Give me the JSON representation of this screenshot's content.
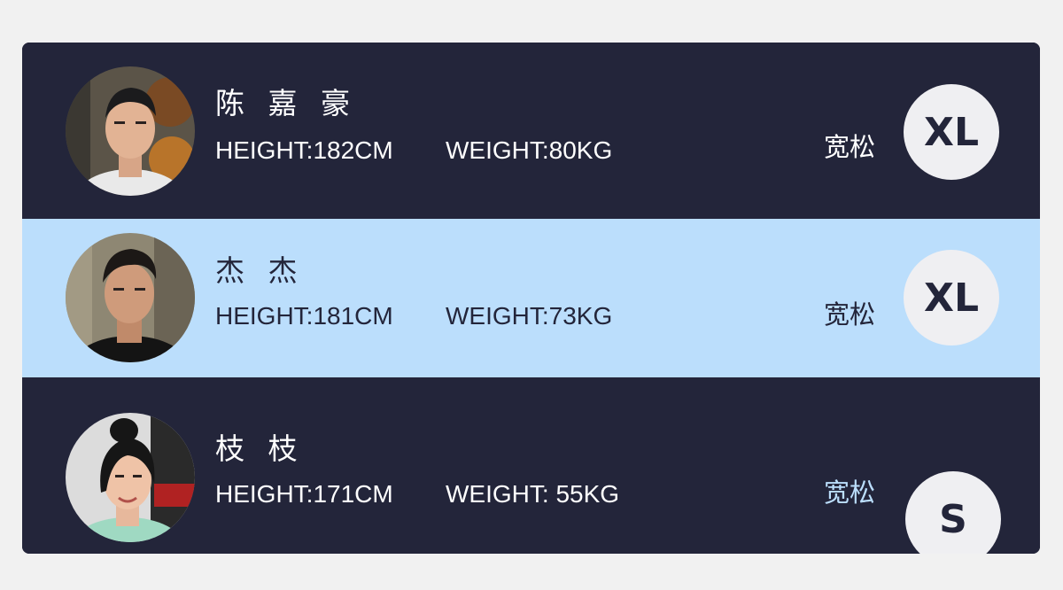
{
  "members": [
    {
      "name": "陈 嘉 豪",
      "height": "HEIGHT:182CM",
      "weight": "WEIGHT:80KG",
      "fit": "宽松",
      "size": "XL",
      "fit_color": "#ffffff"
    },
    {
      "name": "杰 杰",
      "height": "HEIGHT:181CM",
      "weight": "WEIGHT:73KG",
      "fit": "宽松",
      "size": "XL",
      "fit_color": "#23253a"
    },
    {
      "name": "枝 枝",
      "height": "HEIGHT:171CM",
      "weight": "WEIGHT: 55KG",
      "fit": "宽松",
      "size": "S",
      "fit_color": "#bbdefc"
    }
  ],
  "colors": {
    "dark_row": "#23253a",
    "highlight_row": "#bbdefc",
    "badge_bg": "#efeff2",
    "page_bg": "#f1f1f1"
  },
  "icons": [
    "avatar-photo",
    "avatar-photo",
    "avatar-photo"
  ]
}
